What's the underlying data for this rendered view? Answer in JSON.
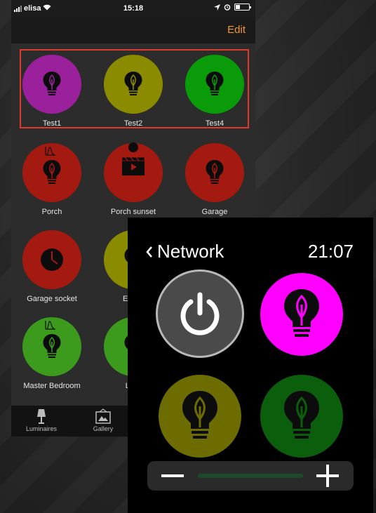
{
  "status": {
    "carrier": "elisa",
    "time": "15:18"
  },
  "nav": {
    "edit_label": "Edit"
  },
  "lamps": [
    {
      "label": "Test1",
      "color": "#9a209c",
      "icon": "bulb-icon"
    },
    {
      "label": "Test2",
      "color": "#8b8b00",
      "icon": "bulb-icon"
    },
    {
      "label": "Test4",
      "color": "#0a9b0a",
      "icon": "bulb-icon"
    },
    {
      "label": "Porch",
      "color": "#a51a10",
      "icon": "bulb-wave-icon"
    },
    {
      "label": "Porch sunset",
      "color": "#a51a10",
      "icon": "video-scene-icon"
    },
    {
      "label": "Garage",
      "color": "#a51a10",
      "icon": "bulb-icon"
    },
    {
      "label": "Garage socket",
      "color": "#a51a10",
      "icon": "clock-icon"
    },
    {
      "label": "Entrar",
      "color": "#8b8b00",
      "icon": "bulb-icon"
    },
    {
      "label": "Master Bedroom",
      "color": "#3c9a1c",
      "icon": "bulb-wave-icon"
    },
    {
      "label": "Livin",
      "color": "#3c9a1c",
      "icon": "bulb-icon"
    }
  ],
  "tabs": [
    {
      "label": "Luminaires",
      "icon": "lamp-icon"
    },
    {
      "label": "Gallery",
      "icon": "gallery-icon"
    }
  ],
  "watch": {
    "back_label": "Network",
    "time": "21:07",
    "power_icon": "power-icon",
    "lamps": [
      {
        "color": "#ff00ff",
        "icon": "bulb-icon"
      },
      {
        "color": "#6c6c00",
        "icon": "bulb-icon"
      },
      {
        "color": "#0b5e0b",
        "icon": "bulb-icon"
      }
    ],
    "brightness_level": 1.0
  },
  "colors": {
    "accent": "#f19a2b",
    "selection": "#e0392a"
  }
}
